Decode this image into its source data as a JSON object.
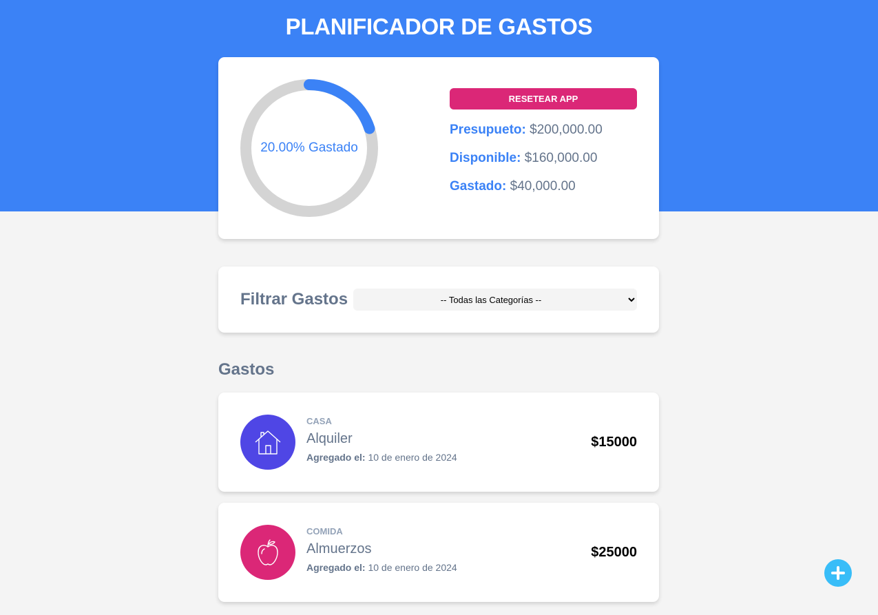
{
  "app": {
    "title": "PLANIFICADOR DE GASTOS"
  },
  "budget": {
    "progress_percent": 20,
    "progress_label": "20.00% Gastado",
    "reset_label": "RESETEAR APP",
    "presupuesto_label": "Presupueto:",
    "presupuesto_value": "$200,000.00",
    "disponible_label": "Disponible:",
    "disponible_value": "$160,000.00",
    "gastado_label": "Gastado:",
    "gastado_value": "$40,000.00"
  },
  "filter": {
    "label": "Filtrar Gastos",
    "selected": "-- Todas las Categorías --"
  },
  "expenses_section": {
    "title": "Gastos",
    "items": [
      {
        "category": "CASA",
        "name": "Alquiler",
        "date_label": "Agregado el:",
        "date": "10 de enero de 2024",
        "amount": "$15000",
        "icon": "house-icon",
        "color": "#4f46e5"
      },
      {
        "category": "COMIDA",
        "name": "Almuerzos",
        "date_label": "Agregado el:",
        "date": "10 de enero de 2024",
        "amount": "$25000",
        "icon": "apple-icon",
        "color": "#db2777"
      }
    ]
  },
  "colors": {
    "primary": "#3b82f6",
    "accent": "#db2777",
    "fab": "#38bdf8",
    "ring_track": "#d4d4d4"
  },
  "fab": {
    "icon": "plus-icon"
  }
}
